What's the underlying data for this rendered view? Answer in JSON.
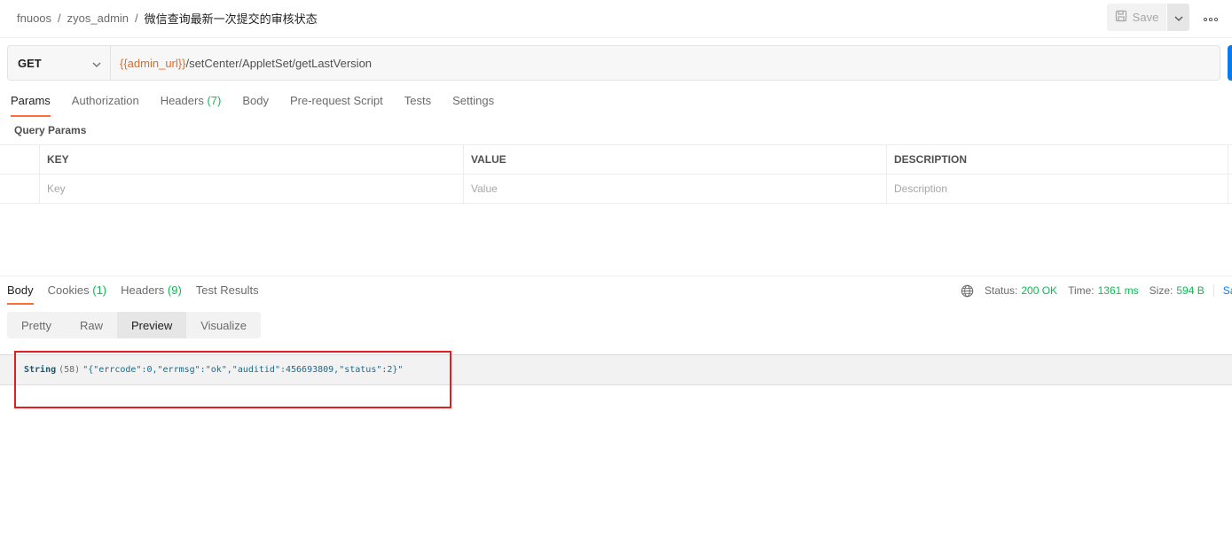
{
  "header": {
    "breadcrumb": [
      "fnuoos",
      "zyos_admin"
    ],
    "separator": "/",
    "request_name": "微信查询最新一次提交的审核状态",
    "save_label": "Save"
  },
  "request": {
    "method": "GET",
    "url_variable": "{{admin_url}}",
    "url_path": "/setCenter/AppletSet/getLastVersion"
  },
  "request_tabs": [
    {
      "label": "Params",
      "count": ""
    },
    {
      "label": "Authorization",
      "count": ""
    },
    {
      "label": "Headers",
      "count": "(7)"
    },
    {
      "label": "Body",
      "count": ""
    },
    {
      "label": "Pre-request Script",
      "count": ""
    },
    {
      "label": "Tests",
      "count": ""
    },
    {
      "label": "Settings",
      "count": ""
    }
  ],
  "query_params": {
    "title": "Query Params",
    "columns": [
      "KEY",
      "VALUE",
      "DESCRIPTION"
    ],
    "placeholders": [
      "Key",
      "Value",
      "Description"
    ]
  },
  "response_tabs": [
    {
      "label": "Body",
      "count": ""
    },
    {
      "label": "Cookies",
      "count": "(1)"
    },
    {
      "label": "Headers",
      "count": "(9)"
    },
    {
      "label": "Test Results",
      "count": ""
    }
  ],
  "response_status": {
    "status_label": "Status:",
    "status_value": "200 OK",
    "time_label": "Time:",
    "time_value": "1361 ms",
    "size_label": "Size:",
    "size_value": "594 B",
    "save_response": "Sa"
  },
  "view_modes": [
    "Pretty",
    "Raw",
    "Preview",
    "Visualize"
  ],
  "preview": {
    "type": "String",
    "length": "(58)",
    "value": "\"{\"errcode\":0,\"errmsg\":\"ok\",\"auditid\":456693809,\"status\":2}\""
  },
  "colors": {
    "accent": "#ff6c37",
    "success": "#0cbb52",
    "url_variable": "#e26b25",
    "highlight": "#e02020",
    "send_button": "#097bed"
  }
}
